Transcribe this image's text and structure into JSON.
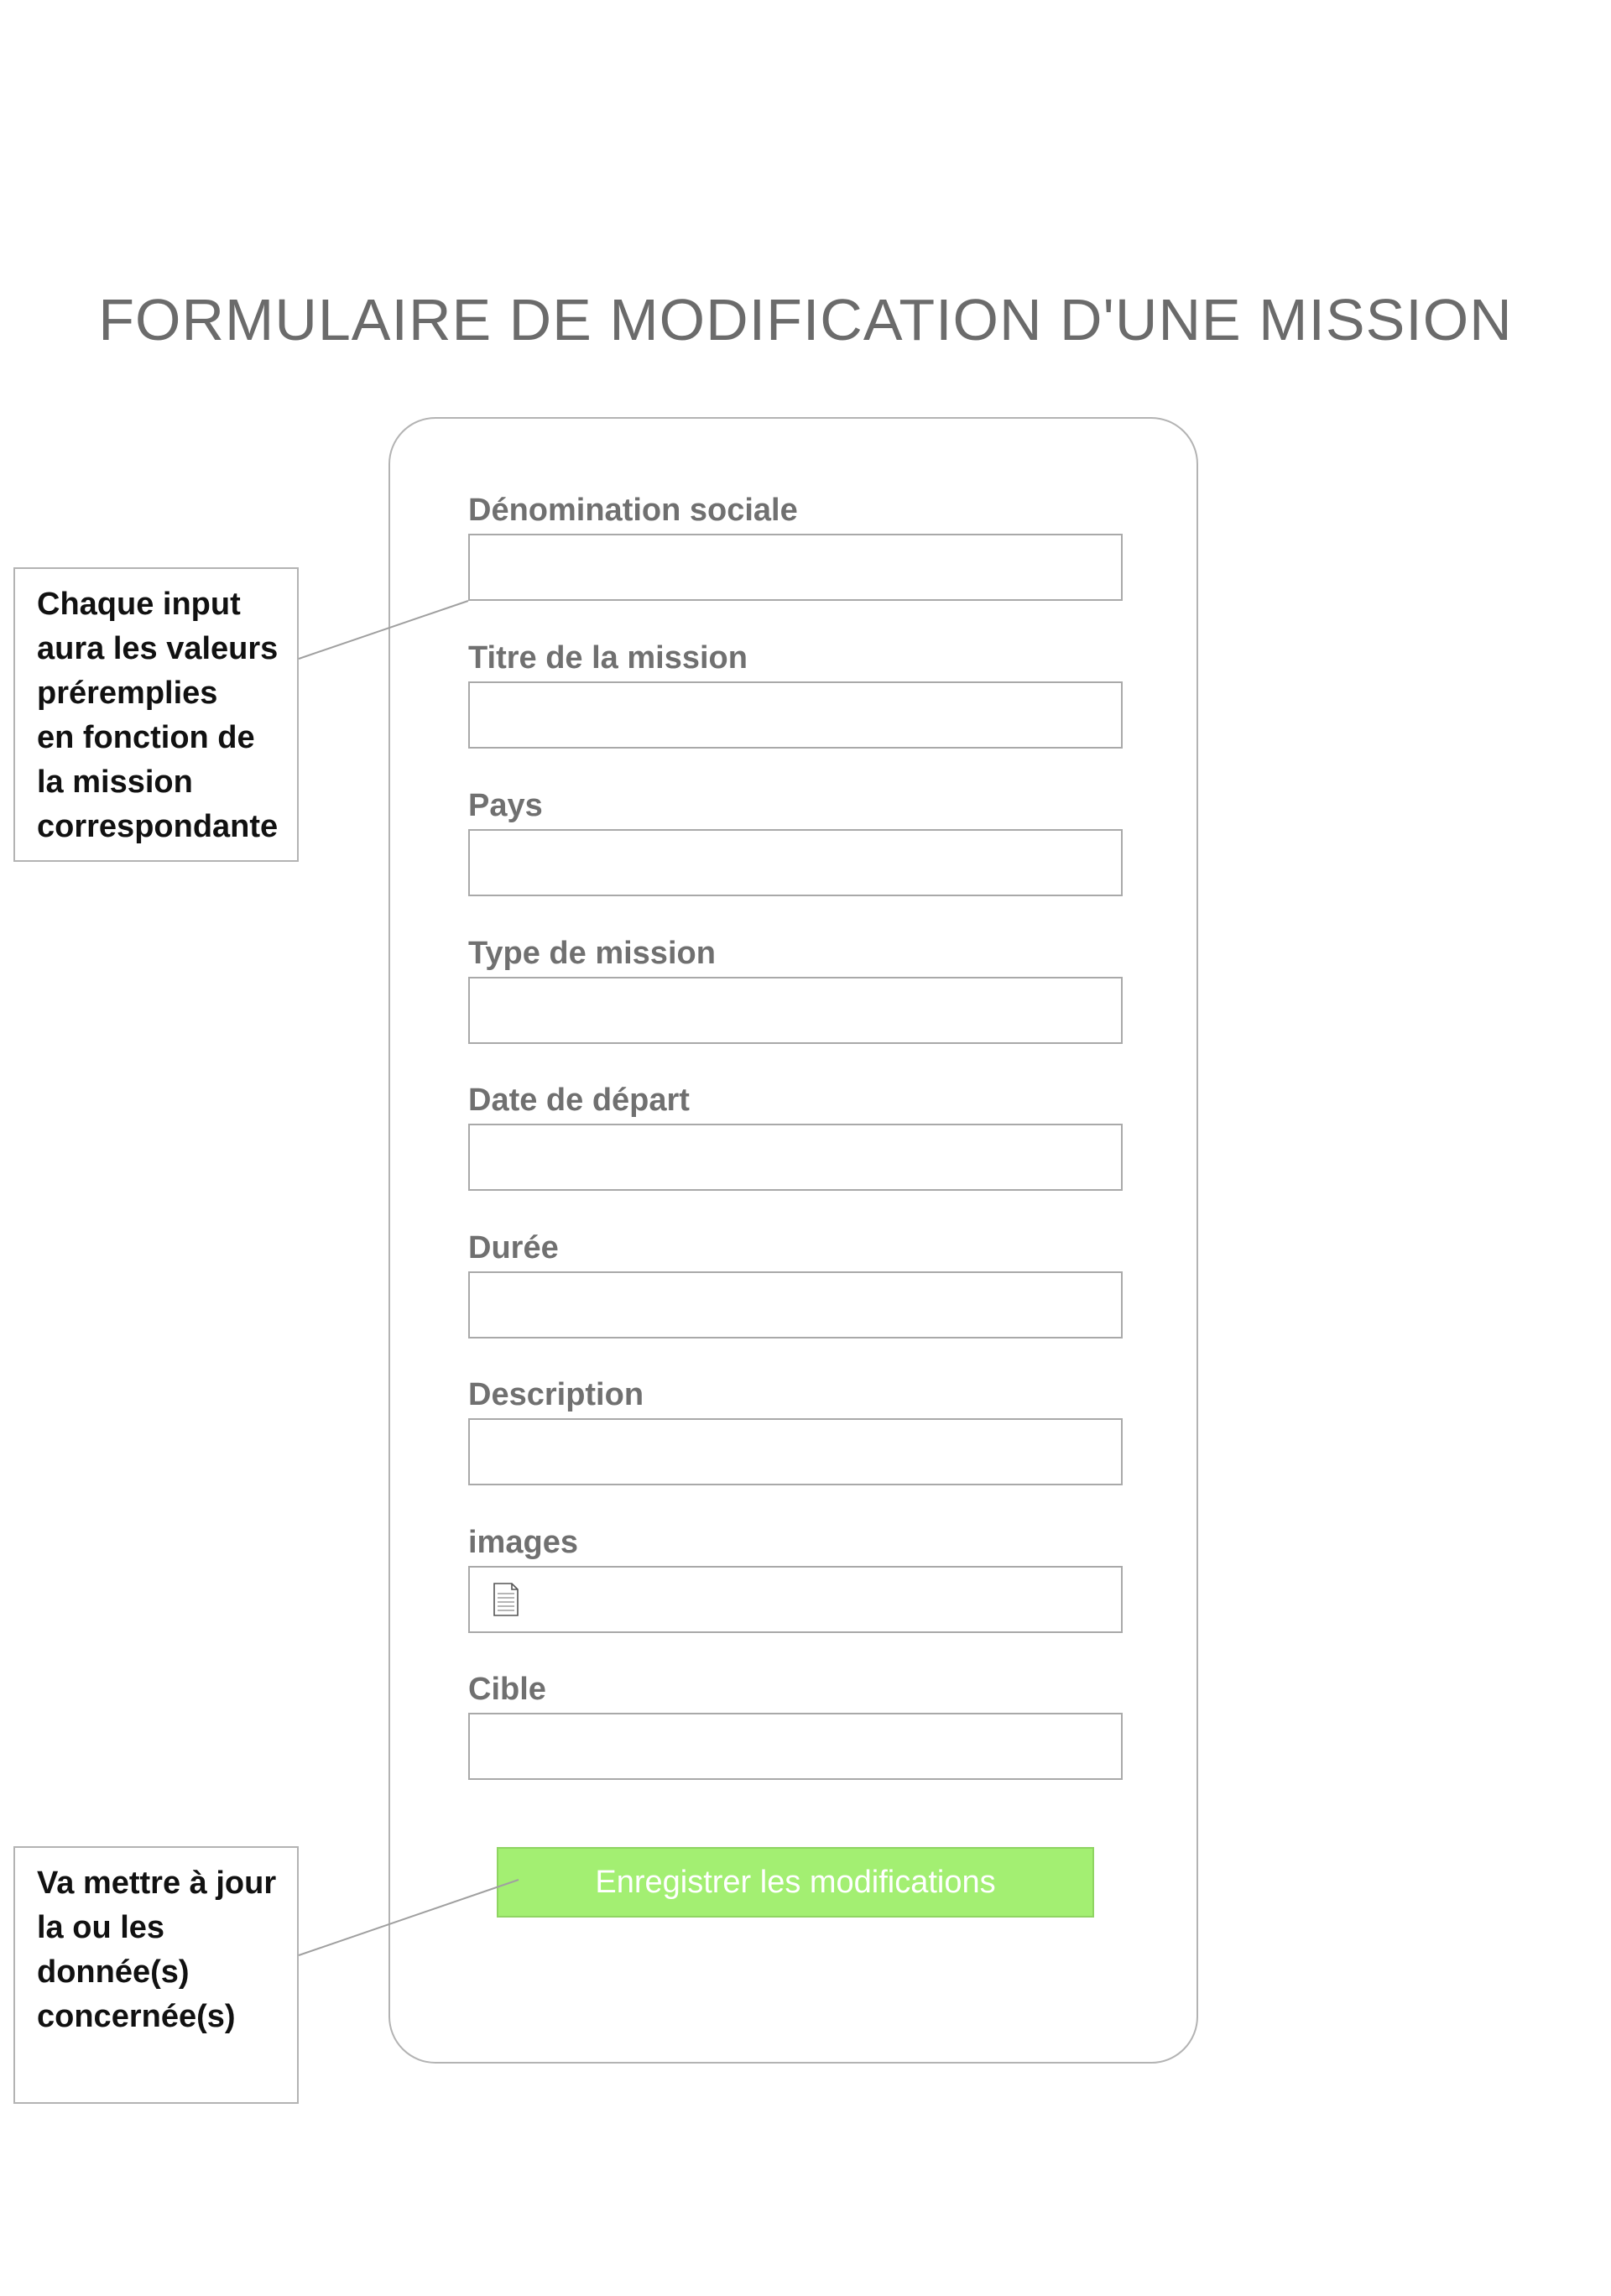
{
  "title": "FORMULAIRE DE MODIFICATION D'UNE MISSION",
  "form": {
    "fields": [
      {
        "label": "Dénomination sociale",
        "value": ""
      },
      {
        "label": "Titre de la mission",
        "value": ""
      },
      {
        "label": "Pays",
        "value": ""
      },
      {
        "label": "Type de mission",
        "value": ""
      },
      {
        "label": "Date de départ",
        "value": ""
      },
      {
        "label": "Durée",
        "value": ""
      },
      {
        "label": "Description",
        "value": ""
      },
      {
        "label": "images",
        "value": "",
        "icon": "file-icon"
      },
      {
        "label": "Cible",
        "value": ""
      }
    ],
    "submit_label": "Enregistrer les modifications"
  },
  "annotations": [
    {
      "text": "Chaque input\naura les valeurs\npréremplies\nen fonction de\nla mission\ncorrespondante"
    },
    {
      "text": "Va mettre à jour\nla ou les\ndonnée(s)\nconcernée(s)"
    }
  ],
  "colors": {
    "title": "#6b6b6b",
    "label": "#707070",
    "border": "#a9a9a9",
    "button_bg": "#a3ef72",
    "button_text": "#ffffff",
    "annotation_text": "#111111"
  }
}
